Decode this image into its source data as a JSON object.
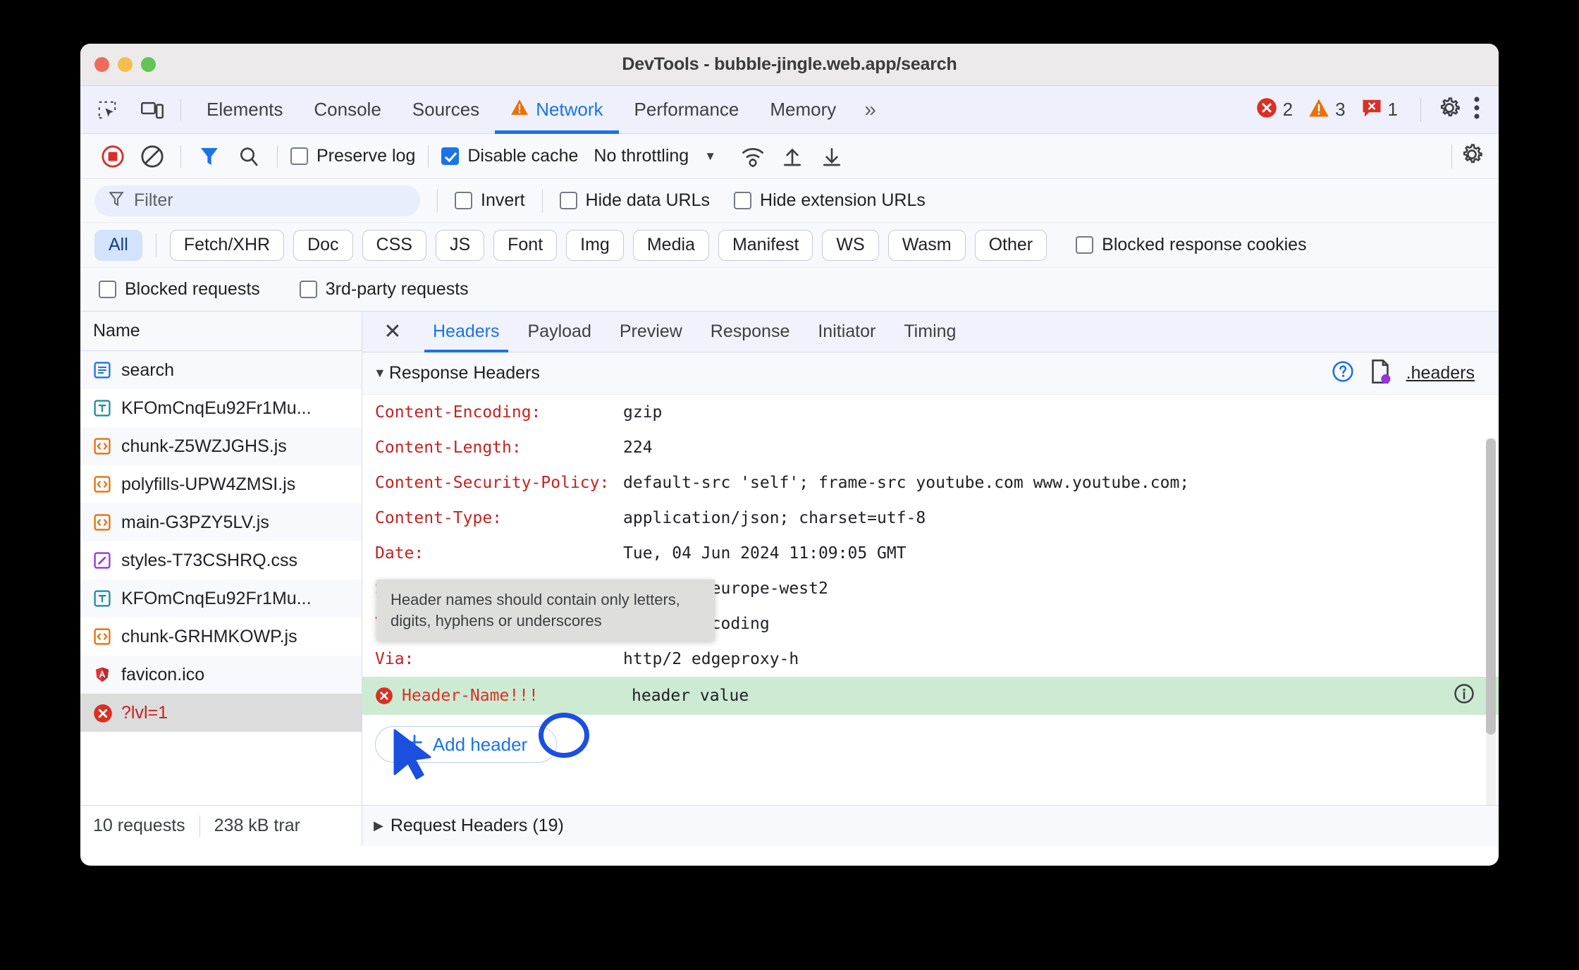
{
  "window": {
    "title": "DevTools - bubble-jingle.web.app/search"
  },
  "tabbar": {
    "tabs": [
      {
        "label": "Elements",
        "active": false
      },
      {
        "label": "Console",
        "active": false
      },
      {
        "label": "Sources",
        "active": false
      },
      {
        "label": "Network",
        "active": true,
        "warning": true
      },
      {
        "label": "Performance",
        "active": false
      },
      {
        "label": "Memory",
        "active": false
      }
    ],
    "overflow": "»",
    "error_count": "2",
    "warning_count": "3",
    "issue_count": "1"
  },
  "netbar": {
    "preserve_log": "Preserve log",
    "disable_cache": "Disable cache",
    "throttling": "No throttling"
  },
  "filterbar": {
    "placeholder": "Filter",
    "invert": "Invert",
    "hide_data_urls": "Hide data URLs",
    "hide_extension_urls": "Hide extension URLs"
  },
  "typefilters": {
    "chips": [
      "All",
      "Fetch/XHR",
      "Doc",
      "CSS",
      "JS",
      "Font",
      "Img",
      "Media",
      "Manifest",
      "WS",
      "Wasm",
      "Other"
    ],
    "active": "All",
    "blocked_response_cookies": "Blocked response cookies",
    "blocked_requests": "Blocked requests",
    "third_party_requests": "3rd-party requests"
  },
  "sidebar": {
    "column_header": "Name",
    "requests": [
      {
        "name": "search",
        "type": "doc",
        "error": false
      },
      {
        "name": "KFOmCnqEu92Fr1Mu...",
        "type": "font",
        "error": false
      },
      {
        "name": "chunk-Z5WZJGHS.js",
        "type": "js",
        "error": false
      },
      {
        "name": "polyfills-UPW4ZMSI.js",
        "type": "js",
        "error": false
      },
      {
        "name": "main-G3PZY5LV.js",
        "type": "js",
        "error": false
      },
      {
        "name": "styles-T73CSHRQ.css",
        "type": "css",
        "error": false
      },
      {
        "name": "KFOmCnqEu92Fr1Mu...",
        "type": "font",
        "error": false
      },
      {
        "name": "chunk-GRHMKOWP.js",
        "type": "js",
        "error": false
      },
      {
        "name": "favicon.ico",
        "type": "img",
        "error": false
      },
      {
        "name": "?lvl=1",
        "type": "error",
        "error": true
      }
    ]
  },
  "detail": {
    "tabs": [
      "Headers",
      "Payload",
      "Preview",
      "Response",
      "Initiator",
      "Timing"
    ],
    "active_tab": "Headers",
    "section_title": "Response Headers",
    "headers_file_link": ".headers",
    "response_headers": [
      {
        "name": "Content-Encoding:",
        "value": "gzip"
      },
      {
        "name": "Content-Length:",
        "value": "224"
      },
      {
        "name": "Content-Security-Policy:",
        "value": "default-src 'self'; frame-src youtube.com www.youtube.com;"
      },
      {
        "name": "Content-Type:",
        "value": "application/json; charset=utf-8"
      },
      {
        "name": "Date:",
        "value": "Tue, 04 Jun 2024 11:09:05 GMT"
      },
      {
        "name": "Server:",
        "value": "deno/gcp-europe-west2"
      },
      {
        "name": "Vary:",
        "value": "Accept-Encoding"
      },
      {
        "name": "Via:",
        "value": "http/2 edgeproxy-h"
      }
    ],
    "editable_header": {
      "name": "Header-Name",
      "invalid_suffix": "!!!",
      "value": "header value"
    },
    "add_header_button": "Add header",
    "tooltip": "Header names should contain only letters, digits, hyphens or underscores",
    "request_headers_label": "Request Headers (19)"
  },
  "status": {
    "requests": "10 requests",
    "transferred": "238 kB trar"
  },
  "colors": {
    "accent": "#1a73e8",
    "error": "#c5221f",
    "warning": "#e8710a",
    "highlight_row": "#cdebd3",
    "annotation": "#1a4fe0"
  }
}
